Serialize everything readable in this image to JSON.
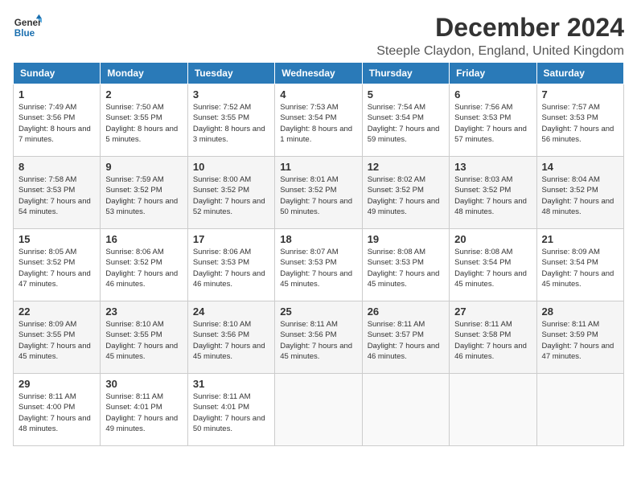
{
  "logo": {
    "line1": "General",
    "line2": "Blue"
  },
  "title": "December 2024",
  "location": "Steeple Claydon, England, United Kingdom",
  "days_of_week": [
    "Sunday",
    "Monday",
    "Tuesday",
    "Wednesday",
    "Thursday",
    "Friday",
    "Saturday"
  ],
  "weeks": [
    [
      {
        "day": "1",
        "sunrise": "7:49 AM",
        "sunset": "3:56 PM",
        "daylight": "8 hours and 7 minutes."
      },
      {
        "day": "2",
        "sunrise": "7:50 AM",
        "sunset": "3:55 PM",
        "daylight": "8 hours and 5 minutes."
      },
      {
        "day": "3",
        "sunrise": "7:52 AM",
        "sunset": "3:55 PM",
        "daylight": "8 hours and 3 minutes."
      },
      {
        "day": "4",
        "sunrise": "7:53 AM",
        "sunset": "3:54 PM",
        "daylight": "8 hours and 1 minute."
      },
      {
        "day": "5",
        "sunrise": "7:54 AM",
        "sunset": "3:54 PM",
        "daylight": "7 hours and 59 minutes."
      },
      {
        "day": "6",
        "sunrise": "7:56 AM",
        "sunset": "3:53 PM",
        "daylight": "7 hours and 57 minutes."
      },
      {
        "day": "7",
        "sunrise": "7:57 AM",
        "sunset": "3:53 PM",
        "daylight": "7 hours and 56 minutes."
      }
    ],
    [
      {
        "day": "8",
        "sunrise": "7:58 AM",
        "sunset": "3:53 PM",
        "daylight": "7 hours and 54 minutes."
      },
      {
        "day": "9",
        "sunrise": "7:59 AM",
        "sunset": "3:52 PM",
        "daylight": "7 hours and 53 minutes."
      },
      {
        "day": "10",
        "sunrise": "8:00 AM",
        "sunset": "3:52 PM",
        "daylight": "7 hours and 52 minutes."
      },
      {
        "day": "11",
        "sunrise": "8:01 AM",
        "sunset": "3:52 PM",
        "daylight": "7 hours and 50 minutes."
      },
      {
        "day": "12",
        "sunrise": "8:02 AM",
        "sunset": "3:52 PM",
        "daylight": "7 hours and 49 minutes."
      },
      {
        "day": "13",
        "sunrise": "8:03 AM",
        "sunset": "3:52 PM",
        "daylight": "7 hours and 48 minutes."
      },
      {
        "day": "14",
        "sunrise": "8:04 AM",
        "sunset": "3:52 PM",
        "daylight": "7 hours and 48 minutes."
      }
    ],
    [
      {
        "day": "15",
        "sunrise": "8:05 AM",
        "sunset": "3:52 PM",
        "daylight": "7 hours and 47 minutes."
      },
      {
        "day": "16",
        "sunrise": "8:06 AM",
        "sunset": "3:52 PM",
        "daylight": "7 hours and 46 minutes."
      },
      {
        "day": "17",
        "sunrise": "8:06 AM",
        "sunset": "3:53 PM",
        "daylight": "7 hours and 46 minutes."
      },
      {
        "day": "18",
        "sunrise": "8:07 AM",
        "sunset": "3:53 PM",
        "daylight": "7 hours and 45 minutes."
      },
      {
        "day": "19",
        "sunrise": "8:08 AM",
        "sunset": "3:53 PM",
        "daylight": "7 hours and 45 minutes."
      },
      {
        "day": "20",
        "sunrise": "8:08 AM",
        "sunset": "3:54 PM",
        "daylight": "7 hours and 45 minutes."
      },
      {
        "day": "21",
        "sunrise": "8:09 AM",
        "sunset": "3:54 PM",
        "daylight": "7 hours and 45 minutes."
      }
    ],
    [
      {
        "day": "22",
        "sunrise": "8:09 AM",
        "sunset": "3:55 PM",
        "daylight": "7 hours and 45 minutes."
      },
      {
        "day": "23",
        "sunrise": "8:10 AM",
        "sunset": "3:55 PM",
        "daylight": "7 hours and 45 minutes."
      },
      {
        "day": "24",
        "sunrise": "8:10 AM",
        "sunset": "3:56 PM",
        "daylight": "7 hours and 45 minutes."
      },
      {
        "day": "25",
        "sunrise": "8:11 AM",
        "sunset": "3:56 PM",
        "daylight": "7 hours and 45 minutes."
      },
      {
        "day": "26",
        "sunrise": "8:11 AM",
        "sunset": "3:57 PM",
        "daylight": "7 hours and 46 minutes."
      },
      {
        "day": "27",
        "sunrise": "8:11 AM",
        "sunset": "3:58 PM",
        "daylight": "7 hours and 46 minutes."
      },
      {
        "day": "28",
        "sunrise": "8:11 AM",
        "sunset": "3:59 PM",
        "daylight": "7 hours and 47 minutes."
      }
    ],
    [
      {
        "day": "29",
        "sunrise": "8:11 AM",
        "sunset": "4:00 PM",
        "daylight": "7 hours and 48 minutes."
      },
      {
        "day": "30",
        "sunrise": "8:11 AM",
        "sunset": "4:01 PM",
        "daylight": "7 hours and 49 minutes."
      },
      {
        "day": "31",
        "sunrise": "8:11 AM",
        "sunset": "4:01 PM",
        "daylight": "7 hours and 50 minutes."
      },
      null,
      null,
      null,
      null
    ]
  ]
}
